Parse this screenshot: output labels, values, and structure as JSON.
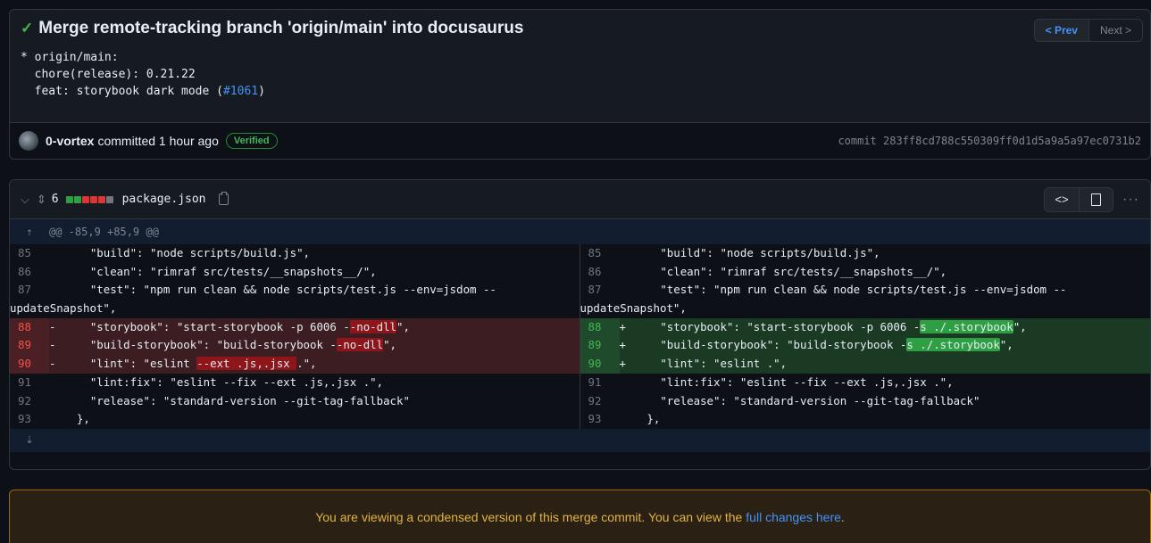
{
  "commit": {
    "title": "Merge remote-tracking branch 'origin/main' into docusaurus",
    "body_line1": "* origin/main:",
    "body_line2": "  chore(release): 0.21.22",
    "body_line3_prefix": "  feat: storybook dark mode (",
    "body_issue": "#1061",
    "body_line3_suffix": ")",
    "prev_label": "< Prev",
    "next_label": "Next >",
    "author": "0-vortex",
    "committed_text": "committed 1 hour ago",
    "verified_label": "Verified",
    "sha_text": "commit 283ff8cd788c550309ff0d1d5a9a5a97ec0731b2"
  },
  "file": {
    "change_count": "6",
    "name": "package.json",
    "hunk": "@@ -85,9 +85,9 @@",
    "blocks": [
      "#2ea043",
      "#2ea043",
      "#da3633",
      "#da3633",
      "#da3633",
      "#6e7681"
    ]
  },
  "left": [
    {
      "n": "85",
      "m": "",
      "pre": "    \"build\": \"node scripts/build.js\",",
      "hl": "",
      "post": "",
      "type": "ctx"
    },
    {
      "n": "86",
      "m": "",
      "pre": "    \"clean\": \"rimraf src/tests/__snapshots__/\",",
      "hl": "",
      "post": "",
      "type": "ctx"
    },
    {
      "n": "87",
      "m": "",
      "pre": "    \"test\": \"npm run clean && node scripts/test.js --env=jsdom --",
      "hl": "",
      "post": "",
      "type": "ctx"
    },
    {
      "n": "",
      "m": "",
      "pre": "updateSnapshot\",",
      "hl": "",
      "post": "",
      "type": "wrap"
    },
    {
      "n": "88",
      "m": "-",
      "pre": "    \"storybook\": \"start-storybook -p 6006 -",
      "hl": "-no-dll",
      "post": "\",",
      "type": "del"
    },
    {
      "n": "89",
      "m": "-",
      "pre": "    \"build-storybook\": \"build-storybook -",
      "hl": "-no-dll",
      "post": "\",",
      "type": "del"
    },
    {
      "n": "90",
      "m": "-",
      "pre": "    \"lint\": \"eslint ",
      "hl": "--ext .js,.jsx ",
      "post": ".\",",
      "type": "del"
    },
    {
      "n": "91",
      "m": "",
      "pre": "    \"lint:fix\": \"eslint --fix --ext .js,.jsx .\",",
      "hl": "",
      "post": "",
      "type": "ctx"
    },
    {
      "n": "92",
      "m": "",
      "pre": "    \"release\": \"standard-version --git-tag-fallback\"",
      "hl": "",
      "post": "",
      "type": "ctx"
    },
    {
      "n": "93",
      "m": "",
      "pre": "  },",
      "hl": "",
      "post": "",
      "type": "ctx"
    }
  ],
  "right": [
    {
      "n": "85",
      "m": "",
      "pre": "    \"build\": \"node scripts/build.js\",",
      "hl": "",
      "post": "",
      "type": "ctx"
    },
    {
      "n": "86",
      "m": "",
      "pre": "    \"clean\": \"rimraf src/tests/__snapshots__/\",",
      "hl": "",
      "post": "",
      "type": "ctx"
    },
    {
      "n": "87",
      "m": "",
      "pre": "    \"test\": \"npm run clean && node scripts/test.js --env=jsdom --",
      "hl": "",
      "post": "",
      "type": "ctx"
    },
    {
      "n": "",
      "m": "",
      "pre": "updateSnapshot\",",
      "hl": "",
      "post": "",
      "type": "wrap"
    },
    {
      "n": "88",
      "m": "+",
      "pre": "    \"storybook\": \"start-storybook -p 6006 -",
      "hl": "s ./.storybook",
      "post": "\",",
      "type": "add"
    },
    {
      "n": "89",
      "m": "+",
      "pre": "    \"build-storybook\": \"build-storybook -",
      "hl": "s ./.storybook",
      "post": "\",",
      "type": "add"
    },
    {
      "n": "90",
      "m": "+",
      "pre": "    \"lint\": \"eslint .\",",
      "hl": "",
      "post": "",
      "type": "add"
    },
    {
      "n": "91",
      "m": "",
      "pre": "    \"lint:fix\": \"eslint --fix --ext .js,.jsx .\",",
      "hl": "",
      "post": "",
      "type": "ctx"
    },
    {
      "n": "92",
      "m": "",
      "pre": "    \"release\": \"standard-version --git-tag-fallback\"",
      "hl": "",
      "post": "",
      "type": "ctx"
    },
    {
      "n": "93",
      "m": "",
      "pre": "  },",
      "hl": "",
      "post": "",
      "type": "ctx"
    }
  ],
  "notice": {
    "text": "You are viewing a condensed version of this merge commit. You can view the",
    "link": "full changes here",
    "period": "."
  }
}
